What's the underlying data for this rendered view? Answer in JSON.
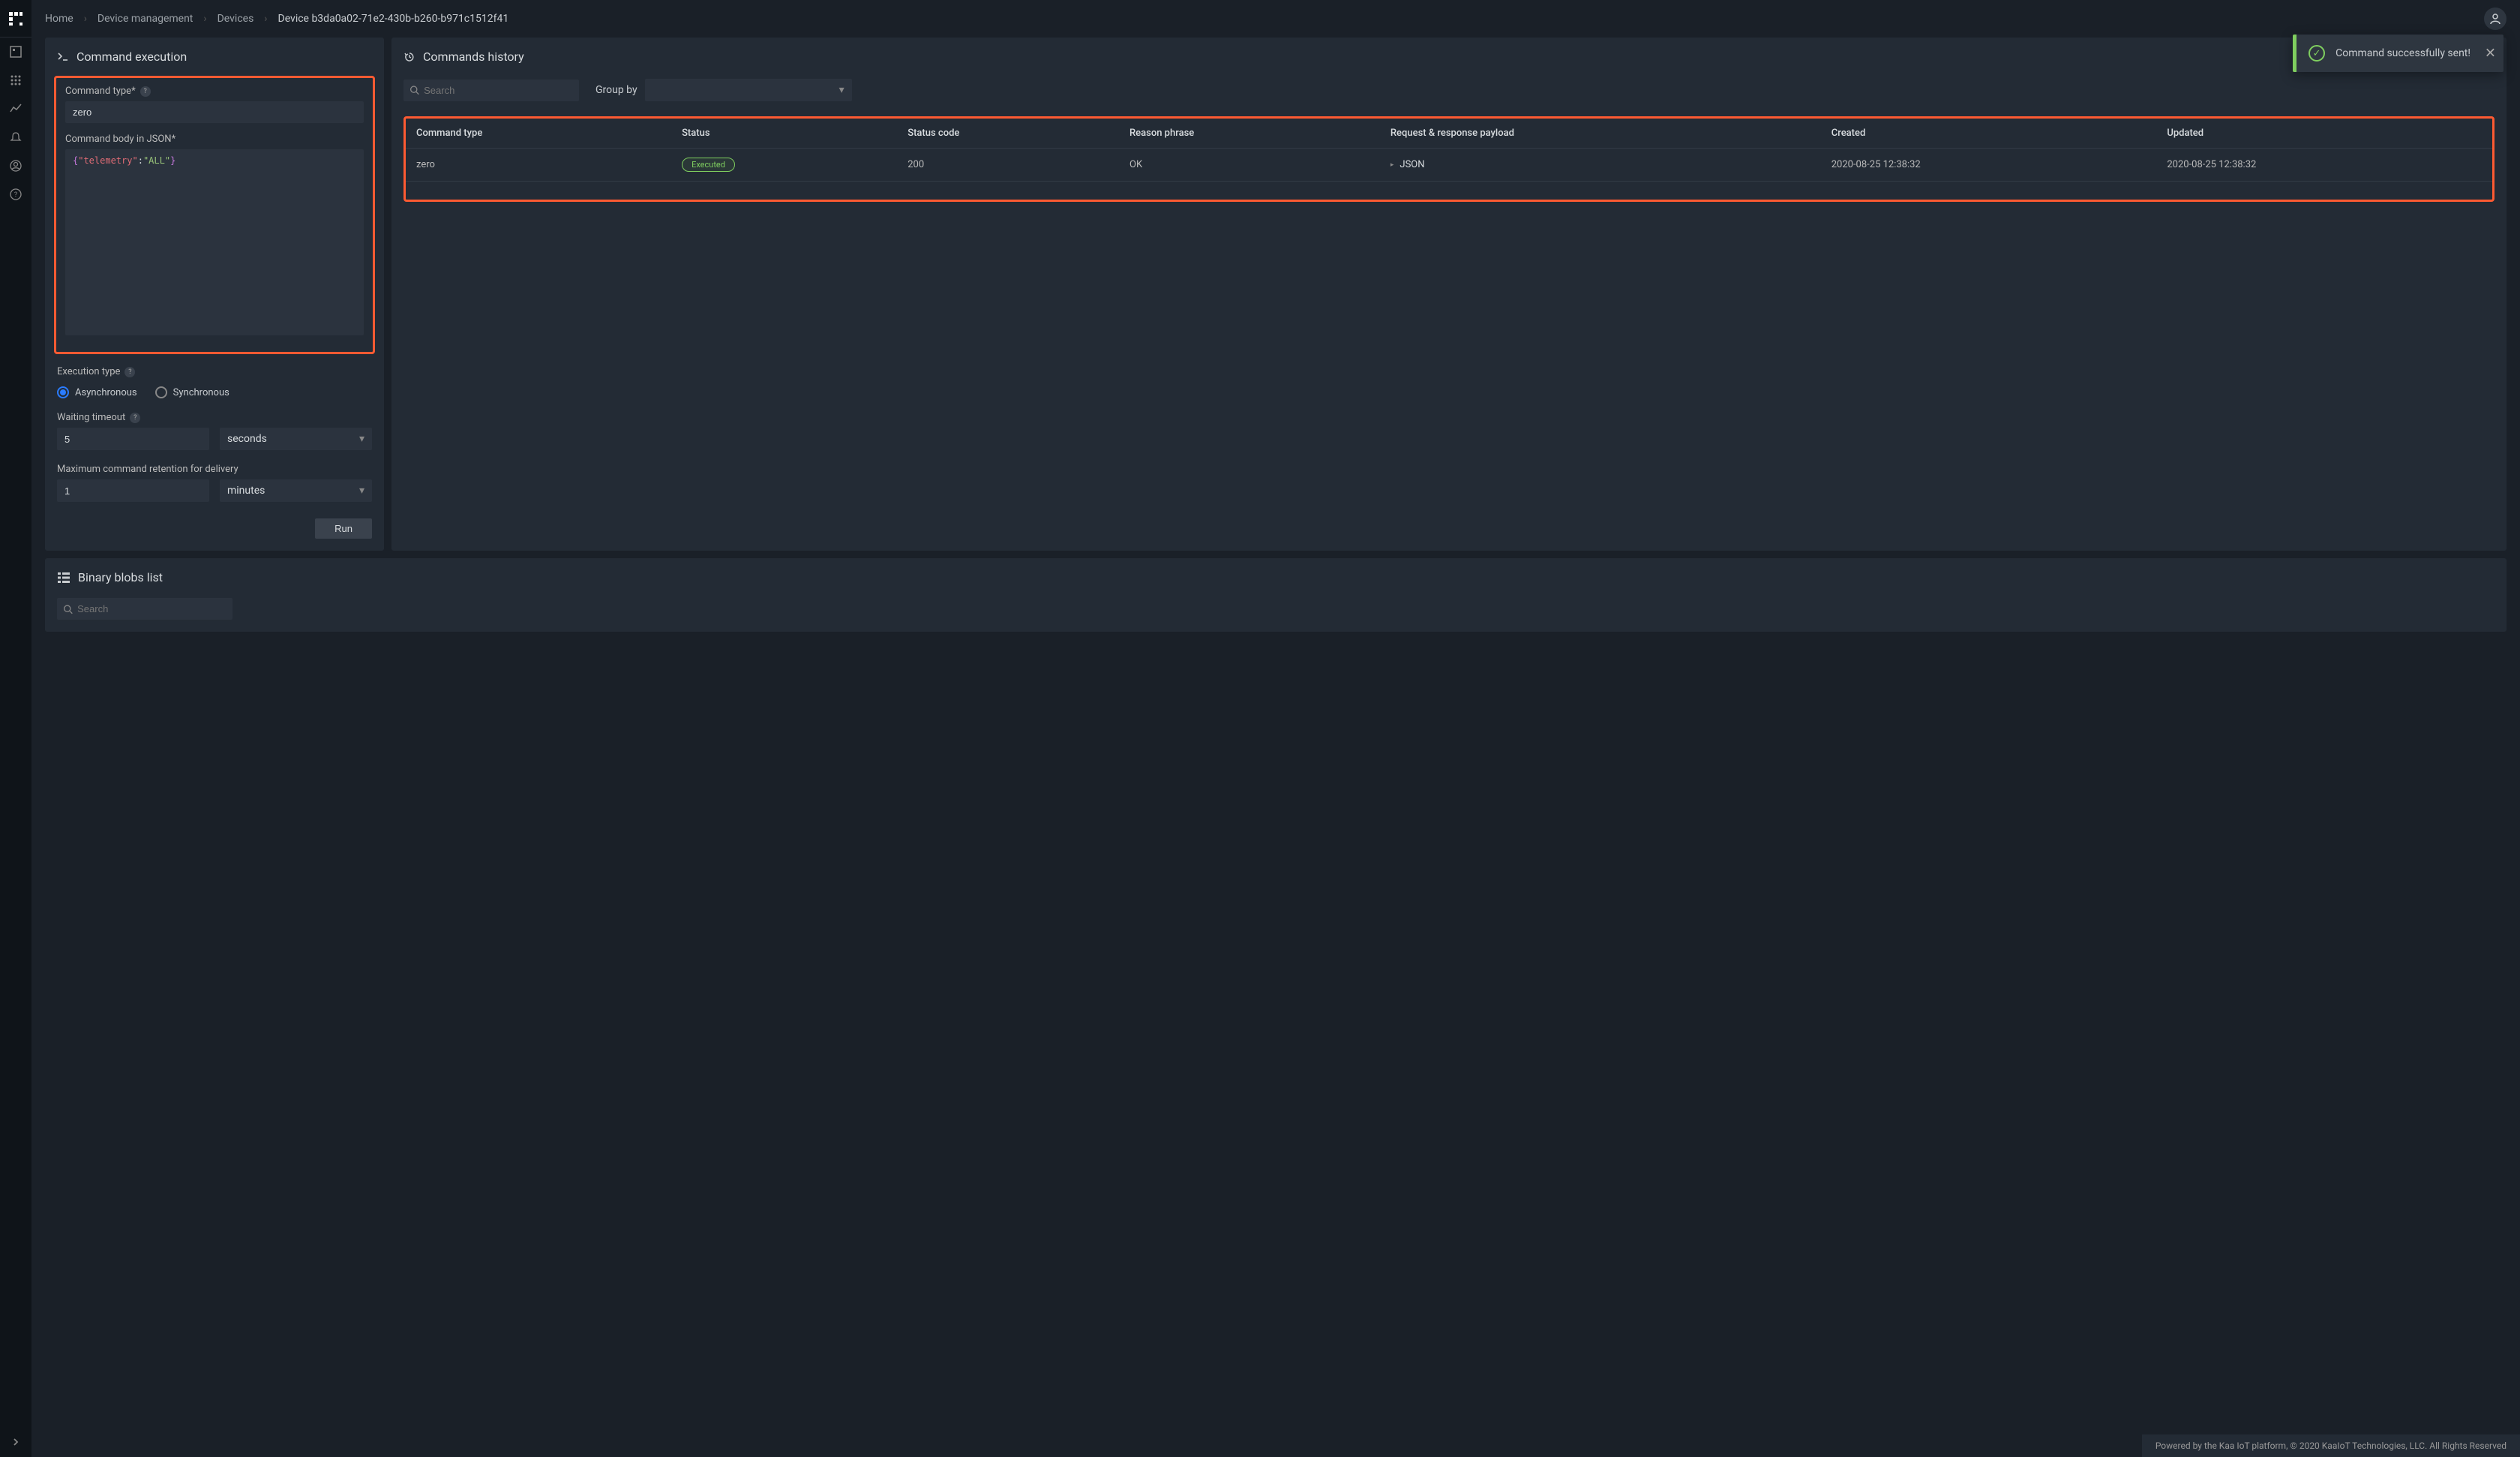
{
  "breadcrumbs": {
    "home": "Home",
    "device_management": "Device management",
    "devices": "Devices",
    "current": "Device b3da0a02-71e2-430b-b260-b971c1512f41"
  },
  "toast": {
    "message": "Command successfully sent!"
  },
  "exec": {
    "title": "Command execution",
    "command_type_label": "Command type*",
    "command_type_value": "zero",
    "command_body_label": "Command body in JSON*",
    "command_body_value": "{\"telemetry\":\"ALL\"}",
    "execution_type_label": "Execution type",
    "async_label": "Asynchronous",
    "sync_label": "Synchronous",
    "waiting_timeout_label": "Waiting timeout",
    "waiting_timeout_value": "5",
    "waiting_timeout_unit": "seconds",
    "max_retention_label": "Maximum command retention for delivery",
    "max_retention_value": "1",
    "max_retention_unit": "minutes",
    "run_label": "Run"
  },
  "history": {
    "title": "Commands history",
    "search_placeholder": "Search",
    "group_by_label": "Group by",
    "columns": {
      "command_type": "Command type",
      "status": "Status",
      "status_code": "Status code",
      "reason_phrase": "Reason phrase",
      "payload": "Request & response payload",
      "created": "Created",
      "updated": "Updated"
    },
    "rows": [
      {
        "command_type": "zero",
        "status": "Executed",
        "status_code": "200",
        "reason_phrase": "OK",
        "payload": "JSON",
        "created": "2020-08-25 12:38:32",
        "updated": "2020-08-25 12:38:32"
      }
    ]
  },
  "blobs": {
    "title": "Binary blobs list",
    "search_placeholder": "Search"
  },
  "footer": {
    "text": "Powered by the Kaa IoT platform, © 2020 KaaIoT Technologies, LLC. All Rights Reserved"
  }
}
